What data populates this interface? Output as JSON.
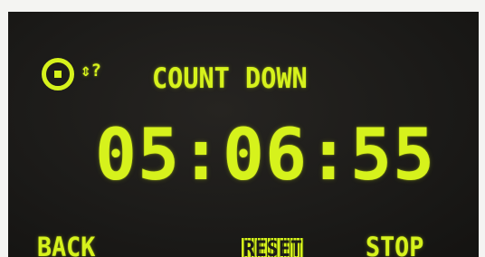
{
  "display": {
    "indicator": "⇕?",
    "mode_title": "COUNT DOWN",
    "timer": "05:06:55",
    "accent_color": "#d6f21c",
    "background_color": "#1c1b19"
  },
  "softkeys": {
    "back_label": "BACK",
    "reset_label": "RESET",
    "stop_label": "STOP"
  },
  "icons": {
    "mode_icon": "target-icon"
  }
}
